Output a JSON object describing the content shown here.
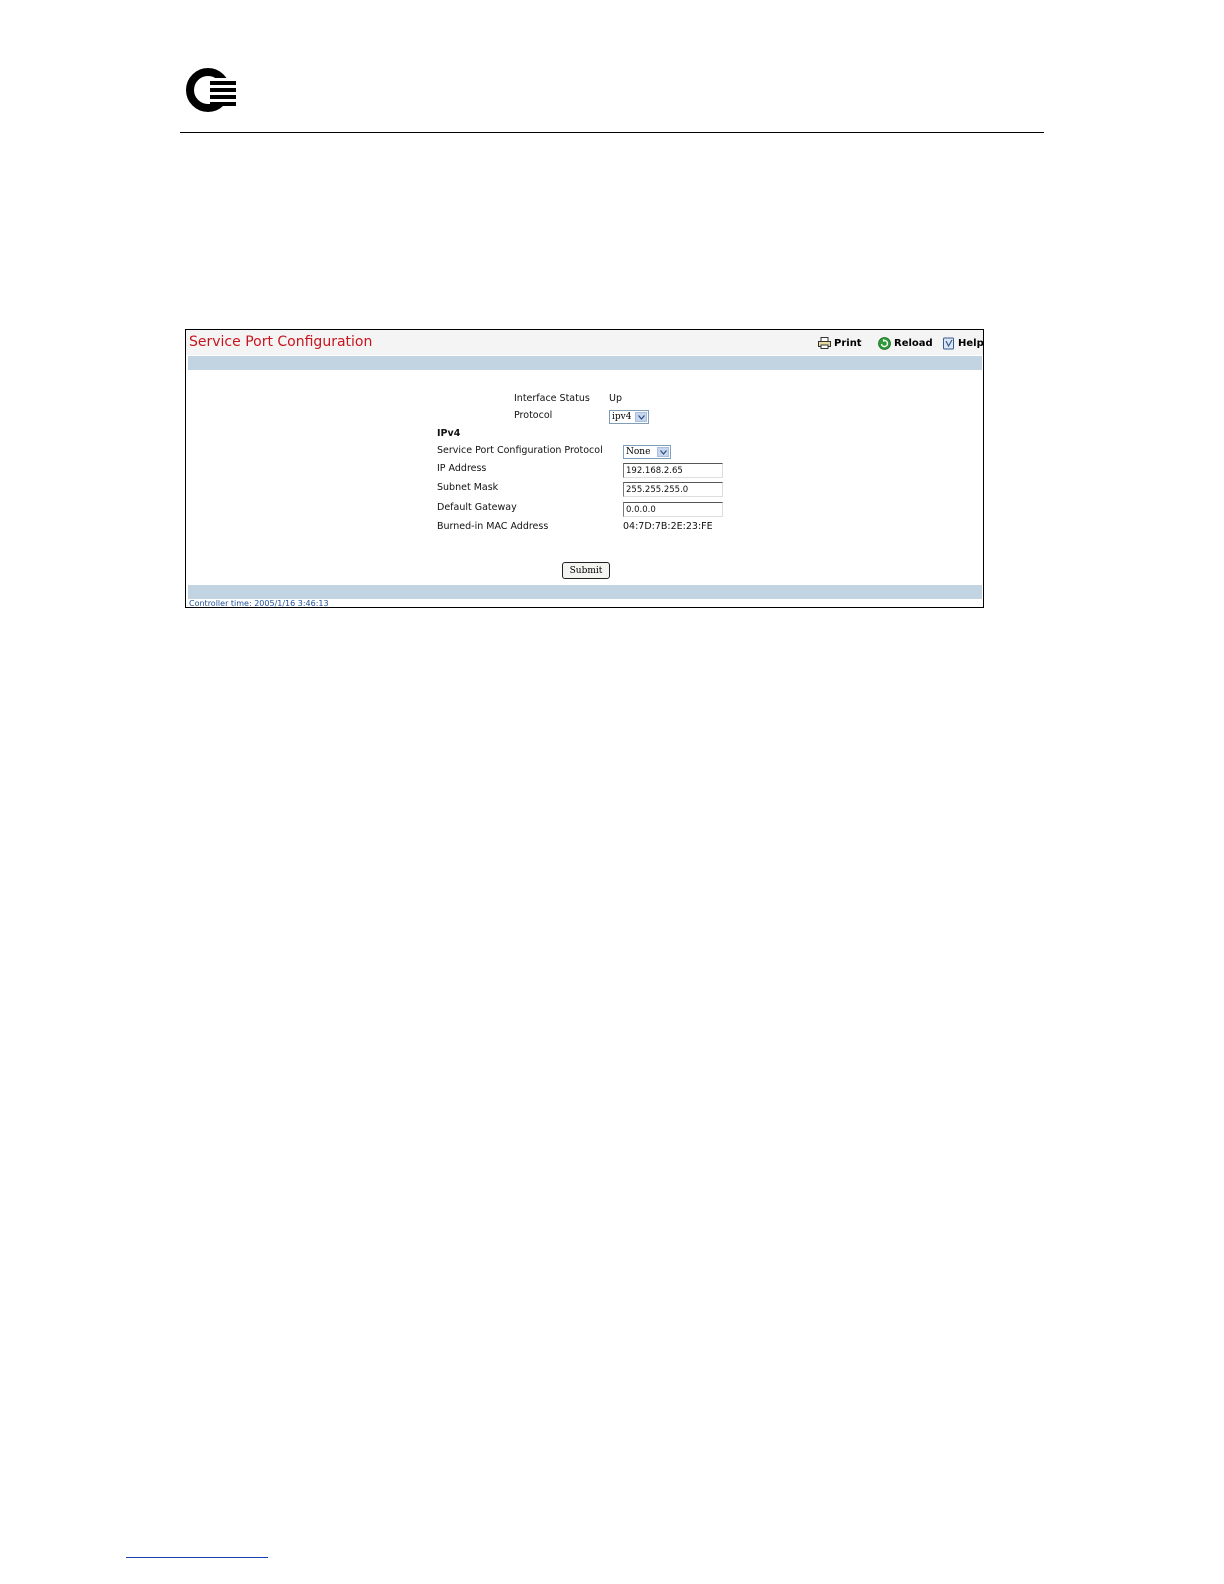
{
  "document": {
    "logo_icon": "q-logo-icon"
  },
  "panel": {
    "title": "Service Port Configuration",
    "actions": {
      "print": "Print",
      "reload": "Reload",
      "help": "Help"
    },
    "icons": {
      "print": "printer-icon",
      "reload": "reload-icon",
      "help": "help-book-icon"
    }
  },
  "form": {
    "interface_status_label": "Interface Status",
    "interface_status_value": "Up",
    "protocol_label": "Protocol",
    "protocol_value": "ipv4",
    "ipv4_heading": "IPv4",
    "sp_config_protocol_label": "Service Port Configuration Protocol",
    "sp_config_protocol_value": "None",
    "ip_address_label": "IP Address",
    "ip_address_value": "192.168.2.65",
    "subnet_mask_label": "Subnet Mask",
    "subnet_mask_value": "255.255.255.0",
    "default_gateway_label": "Default Gateway",
    "default_gateway_value": "0.0.0.0",
    "mac_label": "Burned-in MAC Address",
    "mac_value": "04:7D:7B:2E:23:FE",
    "submit_label": "Submit"
  },
  "footer": {
    "controller_time": "Controller time: 2005/1/16 3:46:13"
  },
  "colors": {
    "title": "#c8141e",
    "band": "#c2d4e2",
    "time_text": "#1e4f96"
  }
}
